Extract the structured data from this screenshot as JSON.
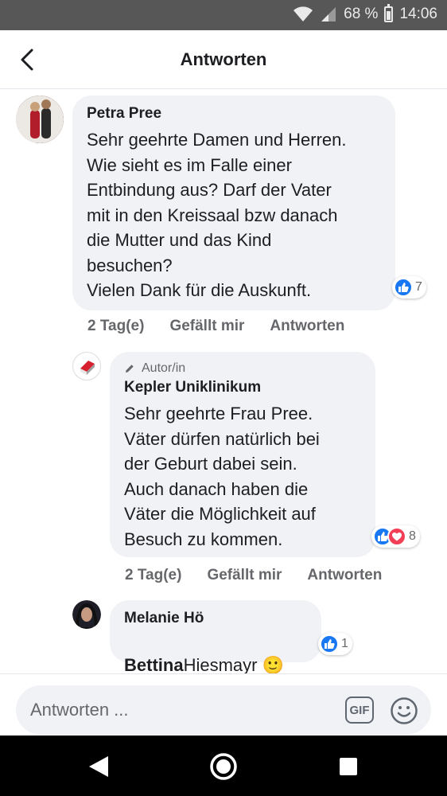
{
  "status": {
    "battery": "68 %",
    "time": "14:06"
  },
  "header": {
    "title": "Antworten"
  },
  "comments": [
    {
      "author": "Petra Pree",
      "text": "Sehr geehrte Damen und Herren.\nWie  sieht es im Falle einer\nEntbindung aus? Darf der Vater\nmit in den Kreissaal bzw danach\ndie Mutter und das Kind\nbesuchen?\nVielen Dank für die Auskunft.",
      "reactions": "7",
      "age": "2 Tag(e)",
      "like": "Gefällt mir",
      "reply": "Antworten"
    },
    {
      "badge": "Autor/in",
      "author": "Kepler Uniklinikum",
      "text": "Sehr geehrte Frau Pree.\nVäter dürfen natürlich bei\nder Geburt dabei sein.\nAuch danach haben die\nVäter die Möglichkeit auf\nBesuch zu kommen.",
      "reactions": "8",
      "age": "2 Tag(e)",
      "like": "Gefällt mir",
      "reply": "Antworten"
    },
    {
      "author": "Melanie Hö",
      "mention": "Bettina",
      "text_rest": "Hiesmayr 🙂",
      "reactions": "1"
    }
  ],
  "composer": {
    "placeholder": "Antworten ...",
    "gif": "GIF"
  },
  "icons": {
    "back": "chevron-left-icon",
    "like": "thumbs-up-icon",
    "love": "heart-icon",
    "edit": "pencil-icon",
    "emoji": "smiley-icon",
    "nav_back": "triangle-back-icon",
    "nav_home": "circle-home-icon",
    "nav_recents": "square-recents-icon"
  },
  "colors": {
    "like": "#1877f2",
    "love": "#f33e58",
    "bubble": "#f0f2f5",
    "meta": "#65676b"
  }
}
